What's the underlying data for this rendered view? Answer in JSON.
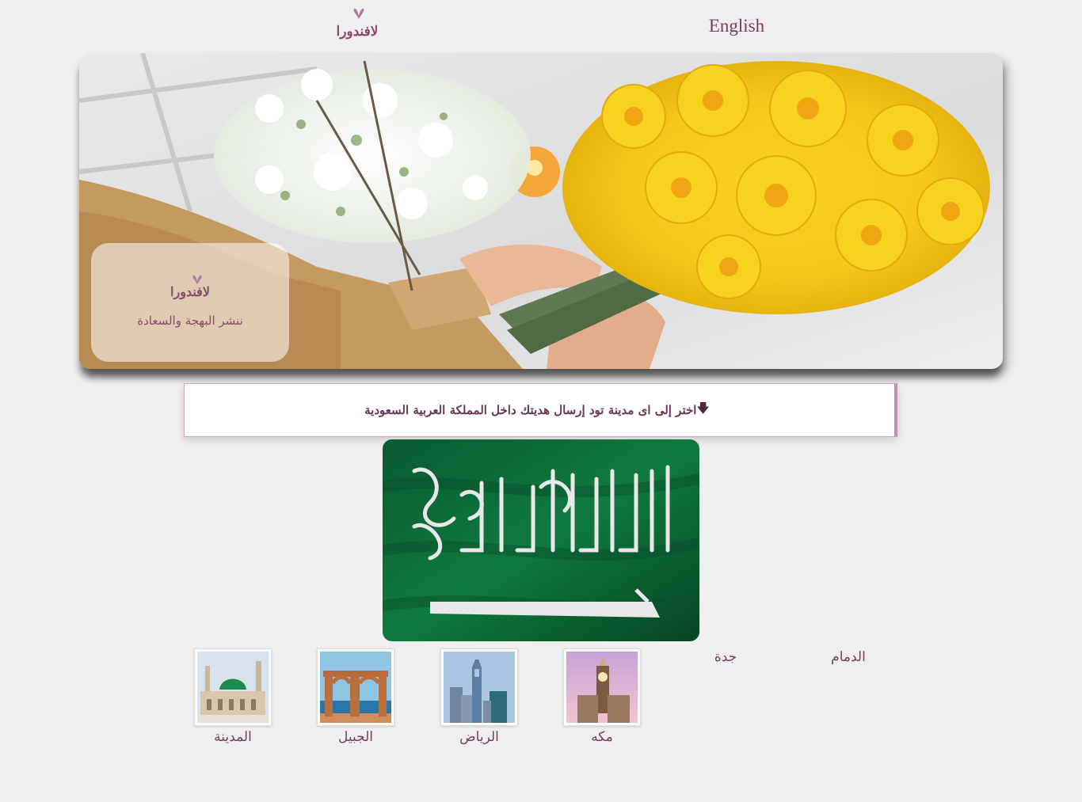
{
  "header": {
    "brand": "لافندورا",
    "language_link": "English"
  },
  "hero": {
    "card_brand": "لافندورا",
    "tagline": "ننشر البهجة والسعادة"
  },
  "prompt": {
    "text": "اختر إلى اى مدينة تود إرسال هديتك داخل المملكة العربية السعودية",
    "icon": "arrow-down-icon"
  },
  "cities": [
    {
      "name": "الدمام",
      "image": false
    },
    {
      "name": "جدة",
      "image": false
    },
    {
      "name": "مكه",
      "image": true,
      "icon": "clock-tower-icon"
    },
    {
      "name": "الرياض",
      "image": true,
      "icon": "skyline-icon"
    },
    {
      "name": "الجبيل",
      "image": true,
      "icon": "arches-icon"
    },
    {
      "name": "المدينة",
      "image": true,
      "icon": "mosque-icon"
    }
  ],
  "colors": {
    "accent": "#7a3d5e",
    "background": "#f0efef",
    "flag_green": "#0b5e32"
  }
}
